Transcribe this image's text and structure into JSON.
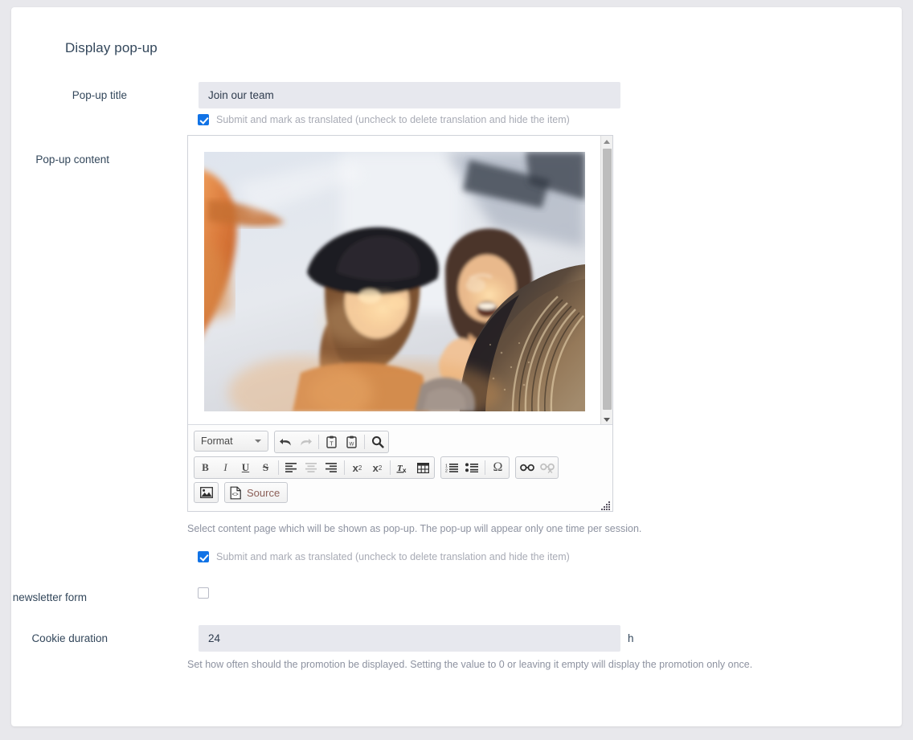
{
  "section": {
    "title": "Display pop-up"
  },
  "fields": {
    "popup_title": {
      "label": "Pop-up title",
      "value": "Join our team",
      "placeholder": "",
      "translate_note": "Submit and mark as translated (uncheck to delete translation and hide the item)",
      "translate_checked": true
    },
    "popup_content": {
      "label": "Pop-up content",
      "help": "Select content page which will be shown as pop-up. The pop-up will appear only one time per session.",
      "translate_note": "Submit and mark as translated (uncheck to delete translation and hide the item)",
      "translate_checked": true
    },
    "newsletter": {
      "label": "Show newsletter form",
      "checked": false
    },
    "cookie_duration": {
      "label": "Cookie duration",
      "value": "24",
      "unit": "h",
      "help": "Set how often should the promotion be displayed. Setting the value to 0 or leaving it empty will display the promotion only once."
    }
  },
  "editor": {
    "format_label": "Format",
    "source_label": "Source",
    "toolbar": {
      "row1": [
        {
          "name": "undo-icon",
          "glyph": "↶",
          "disabled": false
        },
        {
          "name": "redo-icon",
          "glyph": "↷",
          "disabled": true
        },
        {
          "name": "paste-as-text-icon",
          "glyph": "Ὄb",
          "disabled": false
        },
        {
          "name": "paste-from-word-icon",
          "glyph": "Ὄb",
          "disabled": false
        },
        {
          "name": "find-icon",
          "glyph": "ὐd",
          "disabled": false
        }
      ],
      "row2_format": [
        {
          "name": "bold-icon",
          "glyph": "B",
          "disabled": false
        },
        {
          "name": "italic-icon",
          "glyph": "I",
          "disabled": false
        },
        {
          "name": "underline-icon",
          "glyph": "U",
          "disabled": false
        },
        {
          "name": "strikethrough-icon",
          "glyph": "S",
          "disabled": false
        },
        {
          "name": "align-left-icon",
          "glyph": "≡",
          "disabled": false
        },
        {
          "name": "align-center-icon",
          "glyph": "≡",
          "disabled": true
        },
        {
          "name": "align-right-icon",
          "glyph": "≡",
          "disabled": false
        },
        {
          "name": "subscript-icon",
          "glyph": "x₂",
          "disabled": false
        },
        {
          "name": "superscript-icon",
          "glyph": "x²",
          "disabled": false
        },
        {
          "name": "remove-format-icon",
          "glyph": "Tx",
          "disabled": false
        },
        {
          "name": "table-icon",
          "glyph": "▦",
          "disabled": false
        }
      ],
      "row2_lists": [
        {
          "name": "numbered-list-icon",
          "glyph": "1≡",
          "disabled": false
        },
        {
          "name": "bulleted-list-icon",
          "glyph": "•≡",
          "disabled": false
        },
        {
          "name": "special-character-icon",
          "glyph": "Ω",
          "disabled": false
        }
      ],
      "row2_links": [
        {
          "name": "link-icon",
          "glyph": "⚭",
          "disabled": false
        },
        {
          "name": "unlink-icon",
          "glyph": "⚭",
          "disabled": true
        }
      ]
    },
    "scrollbar": {
      "name": "vertical-scrollbar"
    }
  },
  "colors": {
    "accent": "#1173e6",
    "label": "#33475b",
    "input_bg": "#e7e8ee",
    "help_text": "#8d92a0",
    "muted_text": "#a8abb5",
    "page_bg": "#e8e8ec",
    "card_bg": "#ffffff"
  }
}
